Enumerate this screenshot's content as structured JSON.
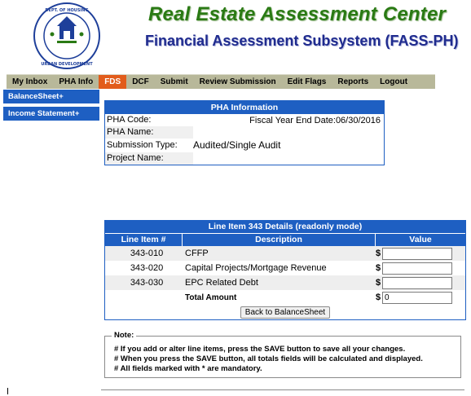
{
  "header": {
    "title": "Real Estate Assessment Center",
    "subtitle": "Financial Assessment Subsystem (FASS-PH)",
    "seal_icon": "hud-seal-icon"
  },
  "nav": {
    "items": [
      "My Inbox",
      "PHA Info",
      "FDS",
      "DCF",
      "Submit",
      "Review Submission",
      "Edit Flags",
      "Reports",
      "Logout"
    ],
    "active": "FDS"
  },
  "sidebar": {
    "items": [
      "BalanceSheet+",
      "Income Statement+"
    ]
  },
  "pha_info": {
    "header": "PHA Information",
    "pha_code_label": "PHA Code:",
    "fiscal_year_end": "Fiscal Year End Date:06/30/2016",
    "pha_name_label": "PHA Name:",
    "submission_type_label": "Submission Type:",
    "submission_type_value": "Audited/Single Audit",
    "project_name_label": "Project Name:"
  },
  "line_item": {
    "title": "Line Item 343 Details (readonly mode)",
    "columns": [
      "Line Item #",
      "Description",
      "Value"
    ],
    "rows": [
      {
        "code": "343-010",
        "desc": "CFFP",
        "value": ""
      },
      {
        "code": "343-020",
        "desc": "Capital Projects/Mortgage Revenue",
        "value": ""
      },
      {
        "code": "343-030",
        "desc": "EPC Related Debt",
        "value": ""
      }
    ],
    "currency_symbol": "$",
    "total_label": "Total Amount",
    "total_value": "0",
    "back_button": "Back to BalanceSheet"
  },
  "note": {
    "legend": "Note:",
    "lines": [
      "# If you add or alter line items, press the SAVE button to save all your changes.",
      "# When you press the SAVE button, all totals fields will be calculated and displayed.",
      "# All fields marked with * are mandatory."
    ]
  },
  "colors": {
    "accent_blue": "#1e5fc2",
    "nav_bg": "#b8b89a",
    "active_tab": "#e25c1b",
    "title_green": "#2a7a14",
    "subtitle_blue": "#1f2b8e"
  }
}
